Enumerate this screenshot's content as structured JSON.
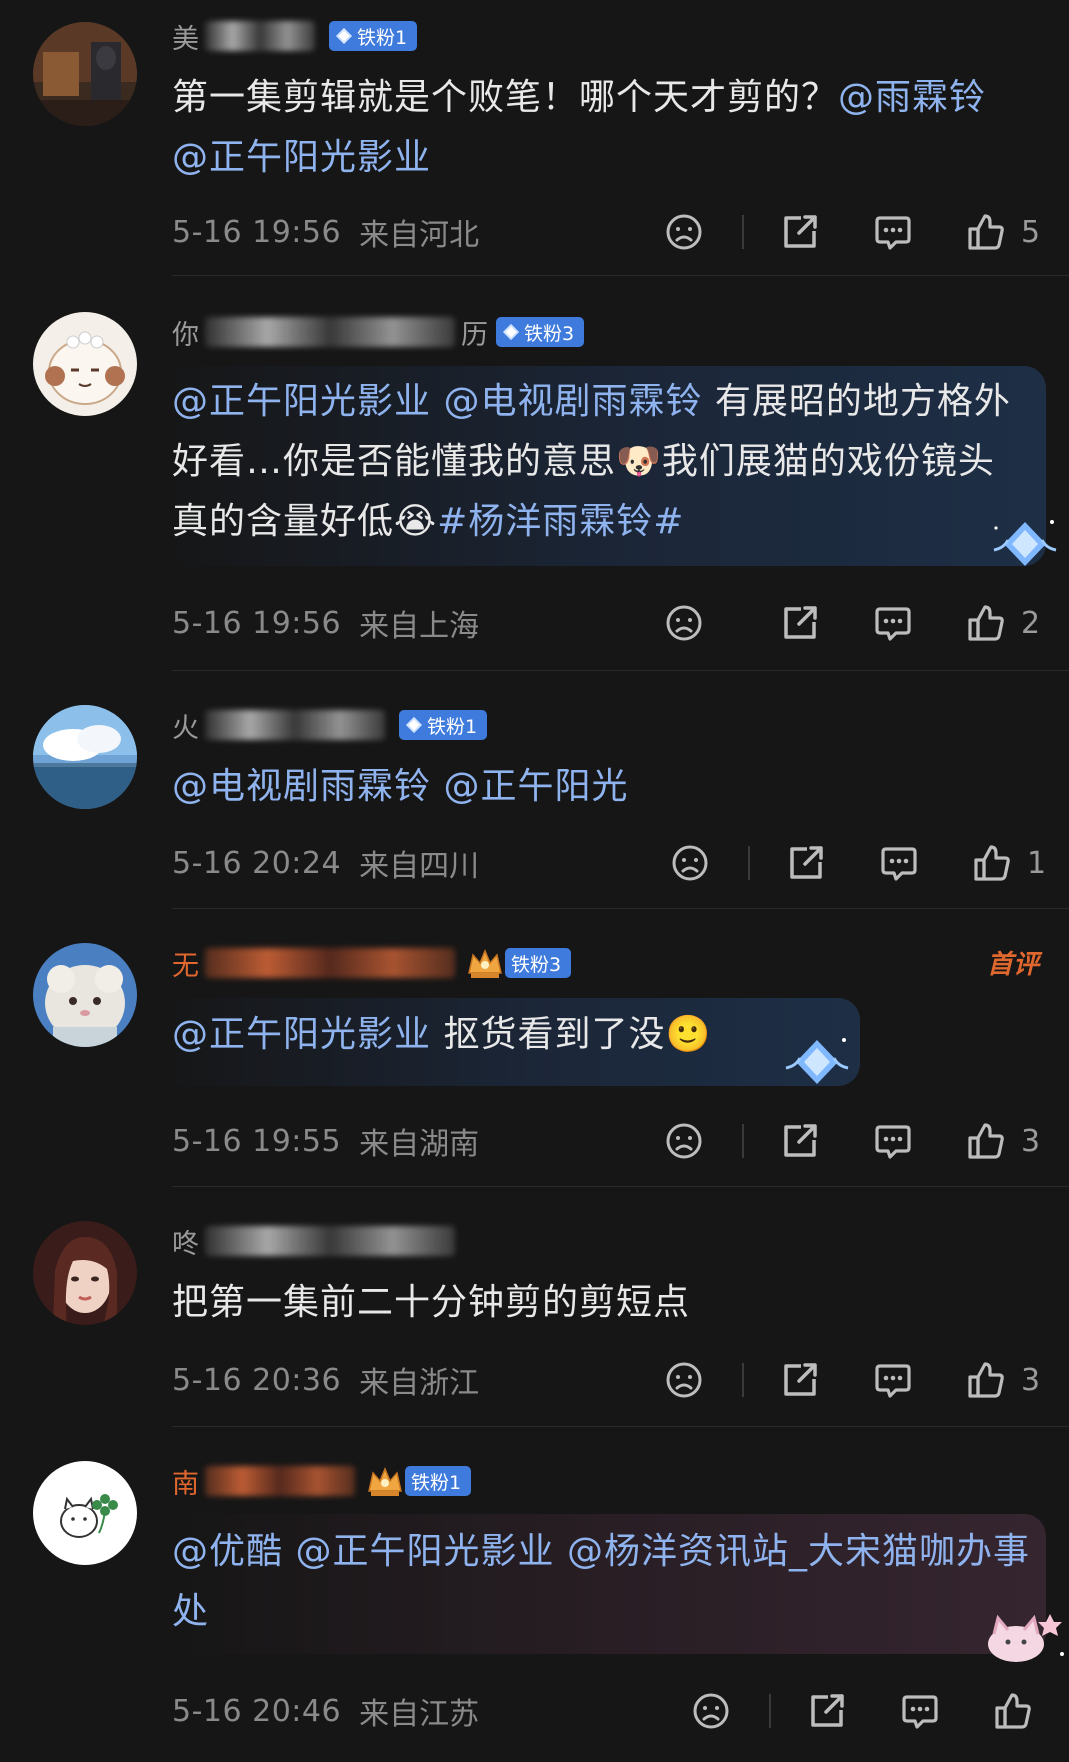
{
  "colors": {
    "background": "#161616",
    "mention": "#8fb3ee",
    "badge": "#3e7bdc",
    "orange_name": "#e0672d",
    "meta": "#8a8a8a"
  },
  "comments": [
    {
      "name_visible": "美",
      "badge": "铁粉1",
      "text_parts": [
        {
          "text": "第一集剪辑就是个败笔！哪个天才剪的？",
          "mention": false
        },
        {
          "text": "@雨霖铃",
          "mention": true
        },
        {
          "text": "@正午阳光影业",
          "mention": true
        }
      ],
      "time": "5-16 19:56",
      "location": "来自河北",
      "likes": "5"
    },
    {
      "name_visible": "你",
      "name_suffix": "历",
      "badge": "铁粉3",
      "text_parts": [
        {
          "text": "@正午阳光影业",
          "mention": true
        },
        {
          "text": " ",
          "mention": false
        },
        {
          "text": "@电视剧雨霖铃",
          "mention": true
        },
        {
          "text": "  有展昭的地方格外好看…你是否能懂我的意思🐶我们展猫的戏份镜头真的含量好低😭",
          "mention": false
        },
        {
          "text": "#杨洋雨霖铃#",
          "mention": true
        }
      ],
      "time": "5-16 19:56",
      "location": "来自上海",
      "likes": "2"
    },
    {
      "name_visible": "火",
      "badge": "铁粉1",
      "text_parts": [
        {
          "text": "@电视剧雨霖铃",
          "mention": true
        },
        {
          "text": " ",
          "mention": false
        },
        {
          "text": "@正午阳光",
          "mention": true
        }
      ],
      "time": "5-16 20:24",
      "location": "来自四川",
      "likes": "1"
    },
    {
      "name_visible": "无",
      "badge": "铁粉3",
      "first_tag": "首评",
      "text_parts": [
        {
          "text": "@正午阳光影业",
          "mention": true
        },
        {
          "text": " 抠货看到了没🙂",
          "mention": false
        }
      ],
      "time": "5-16 19:55",
      "location": "来自湖南",
      "likes": "3"
    },
    {
      "name_visible": "咚",
      "text_parts": [
        {
          "text": "把第一集前二十分钟剪的剪短点",
          "mention": false
        }
      ],
      "time": "5-16 20:36",
      "location": "来自浙江",
      "likes": "3"
    },
    {
      "name_visible": "南",
      "badge": "铁粉1",
      "text_parts": [
        {
          "text": "@优酷",
          "mention": true
        },
        {
          "text": " ",
          "mention": false
        },
        {
          "text": "@正午阳光影业",
          "mention": true
        },
        {
          "text": " ",
          "mention": false
        },
        {
          "text": "@杨洋资讯站_大宋猫咖办事处",
          "mention": true
        }
      ],
      "time": "5-16 20:46",
      "location": "来自江苏",
      "likes": ""
    }
  ]
}
